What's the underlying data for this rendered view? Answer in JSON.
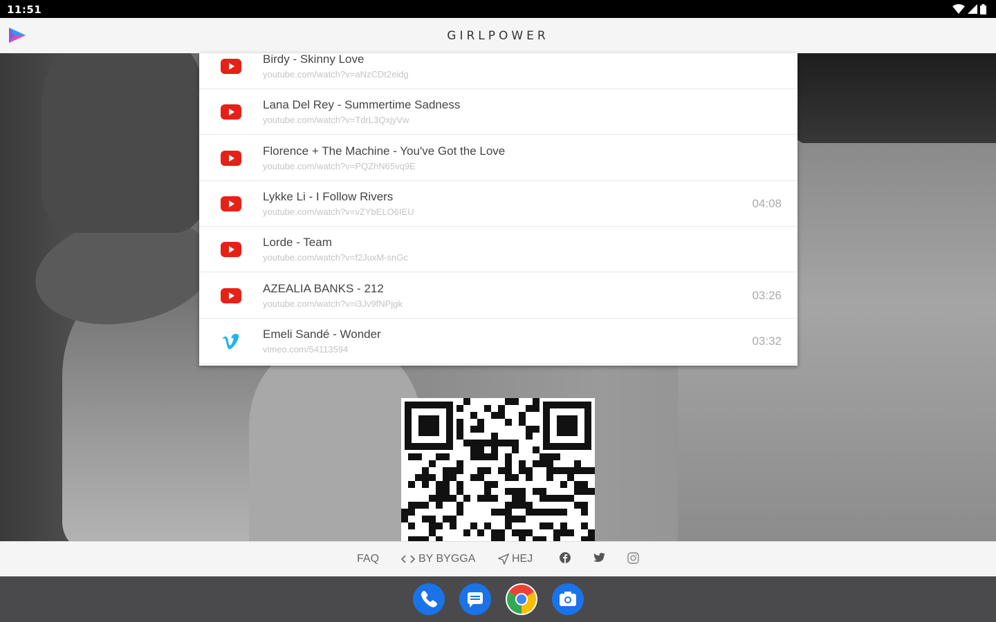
{
  "status_bar": {
    "time": "11:51"
  },
  "app_bar": {
    "title": "GIRLPOWER"
  },
  "tracks": [
    {
      "title": "Birdy - Skinny Love",
      "url": "youtube.com/watch?v=aNzCDt2eidg",
      "duration": "",
      "source": "youtube"
    },
    {
      "title": "Lana Del Rey - Summertime Sadness",
      "url": "youtube.com/watch?v=TdrL3QxjyVw",
      "duration": "",
      "source": "youtube"
    },
    {
      "title": "Florence + The Machine - You've Got the Love",
      "url": "youtube.com/watch?v=PQZhN65vq9E",
      "duration": "",
      "source": "youtube"
    },
    {
      "title": "Lykke Li - I Follow Rivers",
      "url": "youtube.com/watch?v=vZYbELO6IEU",
      "duration": "04:08",
      "source": "youtube"
    },
    {
      "title": "Lorde - Team",
      "url": "youtube.com/watch?v=f2JuxM-snGc",
      "duration": "",
      "source": "youtube"
    },
    {
      "title": "AZEALIA BANKS - 212",
      "url": "youtube.com/watch?v=i3Jv9fNPjgk",
      "duration": "03:26",
      "source": "youtube"
    },
    {
      "title": "Emeli Sandé - Wonder",
      "url": "vimeo.com/54113594",
      "duration": "03:32",
      "source": "vimeo"
    }
  ],
  "footer": {
    "faq": "FAQ",
    "by_bygga": "BY BYGGA",
    "hej": "HEJ"
  },
  "colors": {
    "youtube_red": "#e62117",
    "vimeo_blue": "#1ab7ea"
  },
  "icons": {
    "app_logo": "play-triangle-logo-icon",
    "youtube": "youtube-icon",
    "vimeo": "vimeo-icon",
    "code": "code-icon",
    "send": "send-icon",
    "facebook": "facebook-icon",
    "twitter": "twitter-icon",
    "instagram": "instagram-icon"
  }
}
